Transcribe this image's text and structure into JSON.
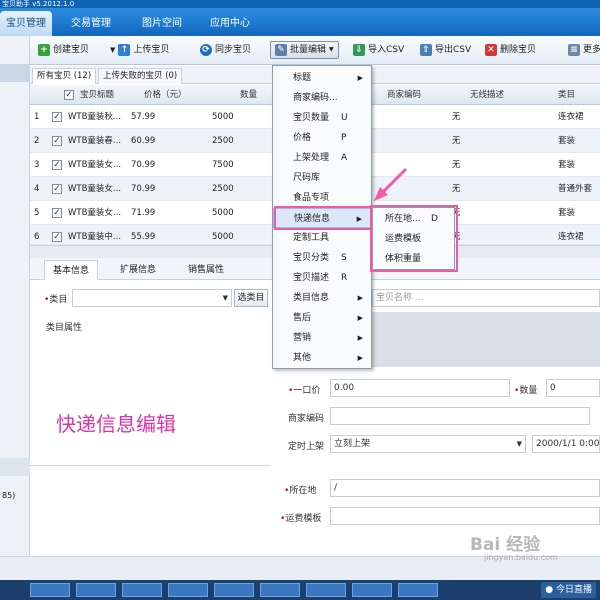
{
  "window": {
    "title": "宝贝助手 v5.2012.1.0"
  },
  "nav": {
    "tabs": [
      "宝贝管理",
      "交易管理",
      "图片空间",
      "应用中心"
    ]
  },
  "toolbar": {
    "create": "创建宝贝",
    "upload": "上传宝贝",
    "sync": "同步宝贝",
    "batch_edit": "批量编辑",
    "import_csv": "导入CSV",
    "export_csv": "导出CSV",
    "delete": "删除宝贝",
    "more": "更多"
  },
  "subtabs": {
    "all": "所有宝贝 (12)",
    "failed": "上传失败的宝贝 (0)"
  },
  "grid": {
    "columns": [
      "宝贝标题",
      "价格（元）",
      "数量",
      "商家编码",
      "无线描述",
      "类目"
    ],
    "rows": [
      {
        "num": "1",
        "title": "WTB童装秋...",
        "price": "57.99",
        "qty": "5000",
        "mobile": "无",
        "category": "连衣裙"
      },
      {
        "num": "2",
        "title": "WTB童装春...",
        "price": "60.99",
        "qty": "2500",
        "mobile": "无",
        "category": "套装"
      },
      {
        "num": "3",
        "title": "WTB童装女...",
        "price": "70.99",
        "qty": "7500",
        "mobile": "无",
        "category": "套装"
      },
      {
        "num": "4",
        "title": "WTB童装女...",
        "price": "70.99",
        "qty": "2500",
        "mobile": "无",
        "category": "普通外套"
      },
      {
        "num": "5",
        "title": "WTB童装女...",
        "price": "71.99",
        "qty": "5000",
        "mobile": "无",
        "category": "套装"
      },
      {
        "num": "6",
        "title": "WTB童装中...",
        "price": "55.99",
        "qty": "5000",
        "mobile": "无",
        "category": "连衣裙"
      }
    ]
  },
  "bottom_tabs": [
    "基本信息",
    "扩展信息",
    "销售属性"
  ],
  "form": {
    "category_label": "类目",
    "select_category": "选类目",
    "category_props": "类目属性",
    "title_placeholder": "宝贝名称 ...",
    "price_label": "一口价",
    "price_value": "0.00",
    "qty_label": "数量",
    "qty_value": "0",
    "merchant_code_label": "商家编码",
    "schedule_label": "定时上架",
    "schedule_value": "立刻上架",
    "schedule_date": "2000/1/1 0:00:",
    "location_label": "所在地",
    "location_value": "/",
    "shipping_template_label": "运费模板"
  },
  "annotation": "快递信息编辑",
  "status": {
    "left_count": "85)"
  },
  "taskbar": {
    "live": "今日直播"
  },
  "watermark": {
    "brand": "Bai 经验",
    "url": "jingyan.baidu.com"
  },
  "menu": {
    "items": [
      {
        "label": "标题",
        "shortcut": "",
        "submenu": true
      },
      {
        "label": "商家编码...",
        "shortcut": "",
        "submenu": false
      },
      {
        "label": "宝贝数量",
        "shortcut": "U",
        "submenu": false
      },
      {
        "label": "价格",
        "shortcut": "P",
        "submenu": false
      },
      {
        "label": "上架处理",
        "shortcut": "A",
        "submenu": false
      },
      {
        "label": "尺码库",
        "shortcut": "",
        "submenu": false
      },
      {
        "label": "食品专项",
        "shortcut": "",
        "submenu": false
      },
      {
        "label": "快递信息",
        "shortcut": "",
        "submenu": true
      },
      {
        "label": "定制工具",
        "shortcut": "",
        "submenu": false
      },
      {
        "label": "宝贝分类",
        "shortcut": "S",
        "submenu": false
      },
      {
        "label": "宝贝描述",
        "shortcut": "R",
        "submenu": false
      },
      {
        "label": "类目信息",
        "shortcut": "",
        "submenu": true
      },
      {
        "label": "售后",
        "shortcut": "",
        "submenu": true
      },
      {
        "label": "营销",
        "shortcut": "",
        "submenu": true
      },
      {
        "label": "其他",
        "shortcut": "",
        "submenu": true
      }
    ]
  },
  "submenu": {
    "items": [
      {
        "label": "所在地...",
        "shortcut": "D"
      },
      {
        "label": "运费模板",
        "shortcut": ""
      },
      {
        "label": "体积重量",
        "shortcut": ""
      }
    ]
  },
  "colors": {
    "accent": "#1266be",
    "highlight": "#f25aa7",
    "annotation": "#e033a8"
  },
  "icons": [
    "plus-icon",
    "upload-icon",
    "sync-icon",
    "batch-edit-icon",
    "import-icon",
    "export-icon",
    "delete-icon",
    "more-icon"
  ]
}
